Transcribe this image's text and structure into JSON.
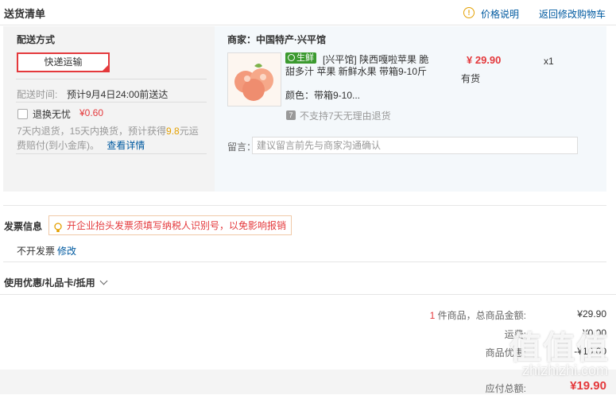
{
  "header": {
    "title": "送货清单",
    "price_info_label": "价格说明",
    "back_to_cart_label": "返回修改购物车"
  },
  "shipping": {
    "section_label": "配送方式",
    "method_label": "快递运输",
    "time_label": "配送时间:",
    "time_value": "预计9月4日24:00前送达",
    "insurance_label": "退换无忧",
    "insurance_price": "¥0.60",
    "insurance_desc_1": "7天内退货，15天内换货，预计获得",
    "insurance_desc_highlight": "9.8",
    "insurance_desc_2": "元运",
    "insurance_desc_3": "费赔付(到小金库)。",
    "insurance_detail_link": "查看详情"
  },
  "merchant": {
    "label": "商家：中国特产·兴平馆"
  },
  "product": {
    "tag": "生鲜",
    "title_line1": "[兴平馆] 陕西嘎啦苹果 脆",
    "title_line2": "甜多汁 苹果 新鲜水果 带箱9-10斤",
    "price": "¥ 29.90",
    "stock": "有货",
    "quantity": "x1",
    "color_label": "颜色：",
    "color_value": "带箱9-10...",
    "return_policy": "不支持7天无理由退货"
  },
  "remark": {
    "label": "留言：",
    "placeholder": "建议留言前先与商家沟通确认"
  },
  "invoice": {
    "title": "发票信息",
    "tip": "开企业抬头发票须填写纳税人识别号，以免影响报销",
    "value": "不开发票",
    "edit_link": "修改"
  },
  "coupon": {
    "title": "使用优惠/礼品卡/抵用"
  },
  "summary": {
    "count": "1",
    "count_label": "件商品，总商品金额:",
    "total": "¥29.90",
    "shipping_label": "运费:",
    "shipping_value": "¥0.00",
    "discount_label": "商品优惠:",
    "discount_value": "-¥10.00",
    "payable_label": "应付总额:",
    "payable_value": "¥19.90"
  },
  "watermark": {
    "main": "值值值",
    "sub": "zhizhizhi.com"
  },
  "colors": {
    "accent_red": "#e4393c",
    "link_blue": "#005aa0",
    "fresh_green": "#3b9a2f"
  }
}
